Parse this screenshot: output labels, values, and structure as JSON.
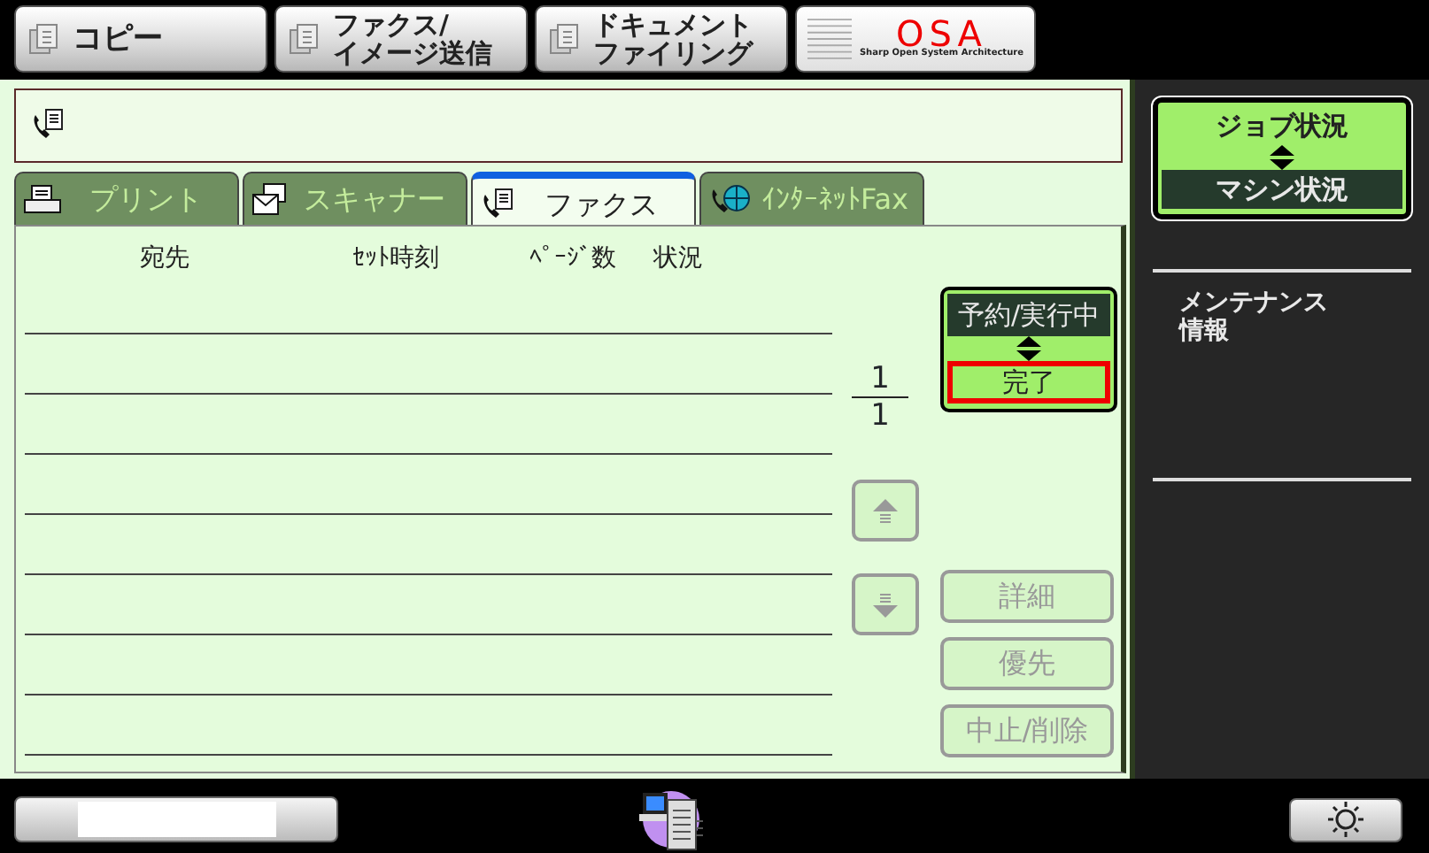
{
  "top_buttons": [
    {
      "kind": "copy",
      "lines": [
        "コピー"
      ]
    },
    {
      "kind": "send",
      "lines": [
        "ファクス/",
        "イメージ送信"
      ]
    },
    {
      "kind": "filing",
      "lines": [
        "ドキュメント",
        "ファイリング"
      ]
    },
    {
      "kind": "osa",
      "lines": [
        "OSA",
        "Sharp Open System Architecture"
      ]
    }
  ],
  "mode_tabs": [
    {
      "label": "プリント",
      "kind": "printer",
      "selected": false
    },
    {
      "label": "スキャナー",
      "kind": "scanner",
      "selected": false
    },
    {
      "label": "ファクス",
      "kind": "fax",
      "selected": true
    },
    {
      "label": "ｲﾝﾀｰﾈｯﾄFax",
      "kind": "ifax",
      "selected": false
    }
  ],
  "table": {
    "columns": [
      "宛先",
      "ｾｯﾄ時刻",
      "ﾍﾟｰｼﾞ数",
      "状況"
    ]
  },
  "page_indicator": {
    "current": "1",
    "total": "1"
  },
  "job_toggle": {
    "kind": "outlined",
    "options": [
      {
        "label": "予約/実行中",
        "selected": false
      },
      {
        "label": "完了",
        "selected": true
      }
    ]
  },
  "scroll_buttons": [
    {
      "kind": "up",
      "disabled": true
    },
    {
      "kind": "down",
      "disabled": true
    }
  ],
  "action_buttons": [
    {
      "label": "詳細",
      "disabled": true
    },
    {
      "label": "優先",
      "disabled": true
    },
    {
      "label": "中止/削除",
      "disabled": true
    }
  ],
  "sidebar": {
    "toggle": {
      "kind": "plain",
      "options": [
        {
          "label": "ジョブ状況",
          "selected": true
        },
        {
          "label": "マシン状況",
          "selected": false
        }
      ]
    },
    "items": [
      {
        "lines": [
          "メンテナンス",
          "情報"
        ]
      }
    ]
  }
}
